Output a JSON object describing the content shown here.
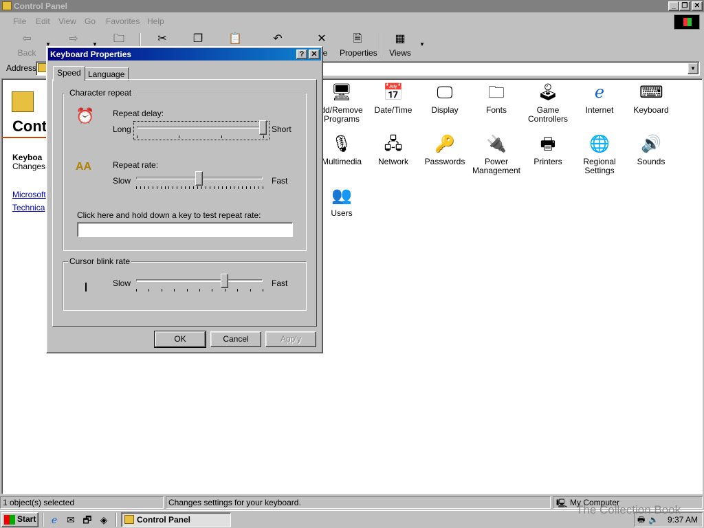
{
  "window": {
    "title": "Control Panel"
  },
  "menu": {
    "file": "File",
    "edit": "Edit",
    "view": "View",
    "go": "Go",
    "favorites": "Favorites",
    "help": "Help"
  },
  "toolbar": {
    "back": "Back",
    "delete_partial": "ete",
    "properties": "Properties",
    "views": "Views"
  },
  "address": {
    "label": "Address"
  },
  "webpane": {
    "title": "Cont",
    "item_name": "Keyboa",
    "item_desc": "Changes",
    "link1": "Microsoft",
    "link2": "Technica"
  },
  "items": [
    {
      "label": "dd/Remove\nPrograms",
      "icon": "add-remove-programs-icon"
    },
    {
      "label": "Date/Time",
      "icon": "date-time-icon"
    },
    {
      "label": "Display",
      "icon": "display-icon"
    },
    {
      "label": "Fonts",
      "icon": "fonts-icon"
    },
    {
      "label": "Game\nControllers",
      "icon": "joystick-icon"
    },
    {
      "label": "Internet",
      "icon": "internet-icon"
    },
    {
      "label": "Keyboard",
      "icon": "keyboard-icon"
    },
    {
      "label": "Multimedia",
      "icon": "multimedia-icon"
    },
    {
      "label": "Network",
      "icon": "network-icon"
    },
    {
      "label": "Passwords",
      "icon": "keys-icon"
    },
    {
      "label": "Power\nManagement",
      "icon": "power-icon"
    },
    {
      "label": "Printers",
      "icon": "printer-icon"
    },
    {
      "label": "Regional\nSettings",
      "icon": "globe-icon"
    },
    {
      "label": "Sounds",
      "icon": "speaker-icon"
    },
    {
      "label": "Users",
      "icon": "users-icon"
    }
  ],
  "status": {
    "selected": "1 object(s) selected",
    "description": "Changes settings for your keyboard.",
    "zone": "My Computer"
  },
  "taskbar": {
    "start": "Start",
    "task": "Control Panel",
    "clock": "9:37 AM"
  },
  "watermark": "The Collection Book",
  "dialog": {
    "title": "Keyboard Properties",
    "help_btn": "?",
    "close_btn": "✕",
    "tabs": [
      "Speed",
      "Language"
    ],
    "char_repeat_group": "Character repeat",
    "repeat_delay_label": "Repeat delay:",
    "repeat_delay_min": "Long",
    "repeat_delay_max": "Short",
    "repeat_delay_value": 1.0,
    "repeat_rate_label": "Repeat rate:",
    "repeat_rate_min": "Slow",
    "repeat_rate_max": "Fast",
    "repeat_rate_value": 0.5,
    "test_label": "Click here and hold down a key to test repeat rate:",
    "test_value": "",
    "cursor_group": "Cursor blink rate",
    "cursor_min": "Slow",
    "cursor_max": "Fast",
    "cursor_value": 0.7,
    "ok": "OK",
    "cancel": "Cancel",
    "apply": "Apply"
  },
  "colors": {
    "titlebar_active": "#000080",
    "titlebar_inactive": "#808080",
    "face": "#c0c0c0"
  }
}
